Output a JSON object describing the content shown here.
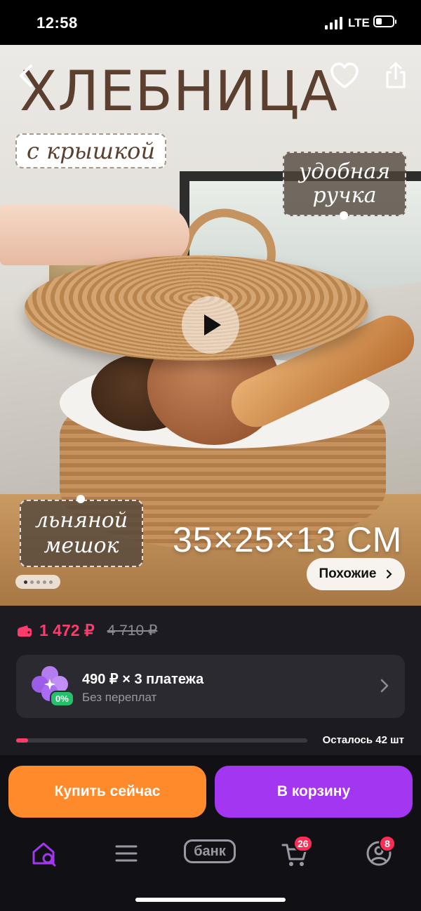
{
  "status_bar": {
    "time": "12:58",
    "network": "LTE"
  },
  "product_image": {
    "title": "ХЛЕБНИЦА",
    "tag_lid": "с крышкой",
    "tag_handle_line1": "удобная",
    "tag_handle_line2": "ручка",
    "tag_bag_line1": "льняной",
    "tag_bag_line2": "мешок",
    "dimensions": "35×25×13 СМ",
    "similar_label": "Похожие",
    "icons": [
      "back-icon",
      "heart-icon",
      "share-icon",
      "play-icon",
      "chevron-right-icon"
    ],
    "carousel_dots": 5,
    "carousel_active": 1
  },
  "price": {
    "current": "1 472 ₽",
    "old": "4 710 ₽",
    "accent": "#ff3b6b"
  },
  "installment": {
    "main": "490 ₽ × 3 платежа",
    "sub": "Без переплат",
    "badge": "0%"
  },
  "stock": {
    "text": "Осталось 42 шт",
    "fill_fraction": 0.04
  },
  "actions": {
    "buy_now": "Купить сейчас",
    "add_to_cart": "В корзину",
    "buy_color": "#ff8a2b",
    "cart_color": "#a336f0"
  },
  "nav": {
    "bank_label": "банк",
    "cart_badge": "26",
    "profile_badge": "8"
  }
}
